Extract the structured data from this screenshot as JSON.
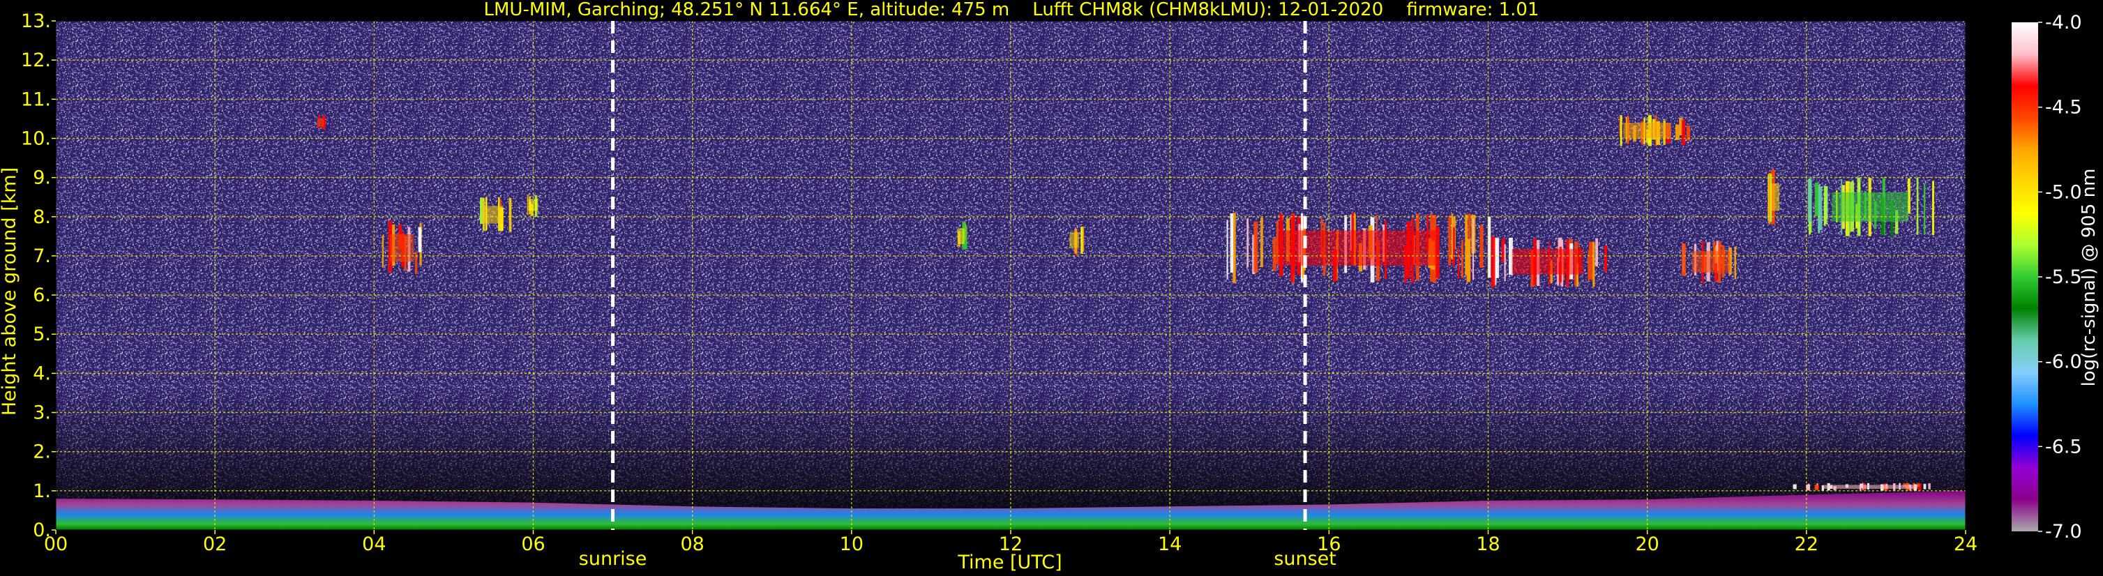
{
  "chart_data": {
    "type": "heatmap",
    "title": "LMU-MIM, Garching; 48.251° N 11.664° E, altitude: 475 m    Lufft CHM8k (CHM8kLMU): 12-01-2020    firmware: 1.01",
    "xlabel": "Time [UTC]",
    "ylabel": "Height above ground [km]",
    "colorbar_label": "log(rc-signal) @ 905 nm",
    "xlim": [
      0,
      24
    ],
    "ylim": [
      0,
      13
    ],
    "x_ticks": [
      {
        "v": 0,
        "label": "00"
      },
      {
        "v": 2,
        "label": "02"
      },
      {
        "v": 4,
        "label": "04"
      },
      {
        "v": 6,
        "label": "06"
      },
      {
        "v": 8,
        "label": "08"
      },
      {
        "v": 10,
        "label": "10"
      },
      {
        "v": 12,
        "label": "12"
      },
      {
        "v": 14,
        "label": "14"
      },
      {
        "v": 16,
        "label": "16"
      },
      {
        "v": 18,
        "label": "18"
      },
      {
        "v": 20,
        "label": "20"
      },
      {
        "v": 22,
        "label": "22"
      },
      {
        "v": 24,
        "label": "24"
      }
    ],
    "y_ticks": [
      {
        "v": 0,
        "label": "0."
      },
      {
        "v": 1,
        "label": "1."
      },
      {
        "v": 2,
        "label": "2."
      },
      {
        "v": 3,
        "label": "3."
      },
      {
        "v": 4,
        "label": "4."
      },
      {
        "v": 5,
        "label": "5."
      },
      {
        "v": 6,
        "label": "6."
      },
      {
        "v": 7,
        "label": "7."
      },
      {
        "v": 8,
        "label": "8."
      },
      {
        "v": 9,
        "label": "9."
      },
      {
        "v": 10,
        "label": "10."
      },
      {
        "v": 11,
        "label": "11."
      },
      {
        "v": 12,
        "label": "12."
      },
      {
        "v": 13,
        "label": "13."
      }
    ],
    "colorbar_range": [
      -7.0,
      -4.0
    ],
    "colorbar_ticks": [
      {
        "v": -4.0,
        "label": "-4.0"
      },
      {
        "v": -4.5,
        "label": "-4.5"
      },
      {
        "v": -5.0,
        "label": "-5.0"
      },
      {
        "v": -5.5,
        "label": "-5.5"
      },
      {
        "v": -6.0,
        "label": "-6.0"
      },
      {
        "v": -6.5,
        "label": "-6.5"
      },
      {
        "v": -7.0,
        "label": "-7.0"
      }
    ],
    "colormap": [
      "#a9a9a9",
      "#8b008b",
      "#9400d3",
      "#0000ff",
      "#1e90ff",
      "#87cefa",
      "#66cdaa",
      "#008000",
      "#32cd32",
      "#adff2f",
      "#ffff00",
      "#ffd700",
      "#ffa500",
      "#ff4500",
      "#ff0000",
      "#ffc0cb",
      "#ffffff"
    ],
    "markers": [
      {
        "x": 7.0,
        "label": "sunrise"
      },
      {
        "x": 15.7,
        "label": "sunset"
      }
    ],
    "boundary_layer": [
      {
        "x": 0,
        "top": 0.8
      },
      {
        "x": 2,
        "top": 0.78
      },
      {
        "x": 4,
        "top": 0.75
      },
      {
        "x": 6,
        "top": 0.7
      },
      {
        "x": 8,
        "top": 0.6
      },
      {
        "x": 10,
        "top": 0.55
      },
      {
        "x": 12,
        "top": 0.55
      },
      {
        "x": 14,
        "top": 0.6
      },
      {
        "x": 16,
        "top": 0.65
      },
      {
        "x": 18,
        "top": 0.75
      },
      {
        "x": 20,
        "top": 0.78
      },
      {
        "x": 22,
        "top": 0.9
      },
      {
        "x": 24,
        "top": 1.0
      }
    ],
    "cloud_patches": [
      {
        "x0": 3.25,
        "x1": 3.4,
        "y0": 10.2,
        "y1": 10.6,
        "level": -4.6
      },
      {
        "x0": 4.1,
        "x1": 4.6,
        "y0": 6.5,
        "y1": 7.9,
        "level": -4.5
      },
      {
        "x0": 5.3,
        "x1": 5.7,
        "y0": 7.6,
        "y1": 8.5,
        "level": -4.9
      },
      {
        "x0": 5.9,
        "x1": 6.1,
        "y0": 8.0,
        "y1": 8.6,
        "level": -5.1
      },
      {
        "x0": 11.3,
        "x1": 11.45,
        "y0": 7.1,
        "y1": 7.9,
        "level": -5.2
      },
      {
        "x0": 12.7,
        "x1": 12.9,
        "y0": 7.0,
        "y1": 7.8,
        "level": -5.0
      },
      {
        "x0": 14.7,
        "x1": 18.0,
        "y0": 6.3,
        "y1": 8.1,
        "level": -4.4
      },
      {
        "x0": 18.0,
        "x1": 19.5,
        "y0": 6.2,
        "y1": 7.5,
        "level": -4.4
      },
      {
        "x0": 20.4,
        "x1": 21.2,
        "y0": 6.3,
        "y1": 7.4,
        "level": -4.5
      },
      {
        "x0": 19.5,
        "x1": 20.5,
        "y0": 9.8,
        "y1": 10.6,
        "level": -4.7
      },
      {
        "x0": 21.5,
        "x1": 21.7,
        "y0": 7.8,
        "y1": 9.2,
        "level": -5.0
      },
      {
        "x0": 22.0,
        "x1": 23.6,
        "y0": 7.5,
        "y1": 9.0,
        "level": -5.5
      },
      {
        "x0": 21.8,
        "x1": 23.8,
        "y0": 1.0,
        "y1": 1.2,
        "level": -4.2
      }
    ]
  }
}
